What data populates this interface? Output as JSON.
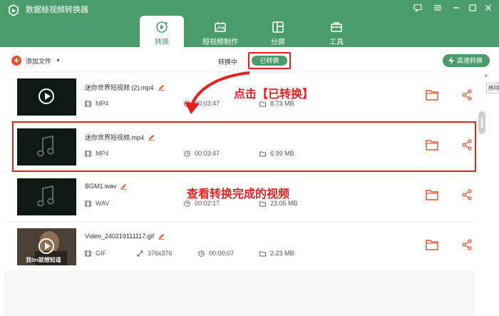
{
  "app": {
    "title": "数据蛙视频转换器"
  },
  "window": {
    "icons": [
      "chat-icon",
      "menu-icon",
      "minimize-icon",
      "maximize-icon",
      "close-icon"
    ]
  },
  "tabs": [
    {
      "label": "转换",
      "icon": "convert-icon",
      "active": true
    },
    {
      "label": "短视频制作",
      "icon": "short-video-icon",
      "active": false
    },
    {
      "label": "分屏",
      "icon": "split-screen-icon",
      "active": false
    },
    {
      "label": "工具",
      "icon": "toolbox-icon",
      "active": false
    }
  ],
  "toolbar": {
    "add_label": "添加文件",
    "converting_label": "转换中",
    "converted_label": "已转换",
    "speed_label": "高速转换"
  },
  "hint": {
    "text": "移除",
    "close": "×"
  },
  "files": [
    {
      "name": "迷你世界短视频 (2).mp4",
      "format": "MP4",
      "duration": "00:03:47",
      "size": "8.73 MB",
      "thumb": "video"
    },
    {
      "name": "迷你世界短视频.mp4",
      "format": "MP4",
      "duration": "00:03:47",
      "size": "6.99 MB",
      "thumb": "audio"
    },
    {
      "name": "BGM1.wav",
      "format": "WAV",
      "duration": "00:02:17",
      "size": "23.05 MB",
      "thumb": "audio"
    },
    {
      "name": "Video_240219111117.gif",
      "format": "GIF",
      "resolution": "376x376",
      "duration": "00:00:07",
      "size": "2.23 MB",
      "thumb": "video",
      "caption": "我tm就想知道"
    }
  ],
  "annotations": {
    "top": "点击【已转换】",
    "bottom": "查看转换完成的视频"
  },
  "colors": {
    "brand": "#4a9d6a",
    "accent": "#e9502c",
    "annotation": "#e82020"
  }
}
